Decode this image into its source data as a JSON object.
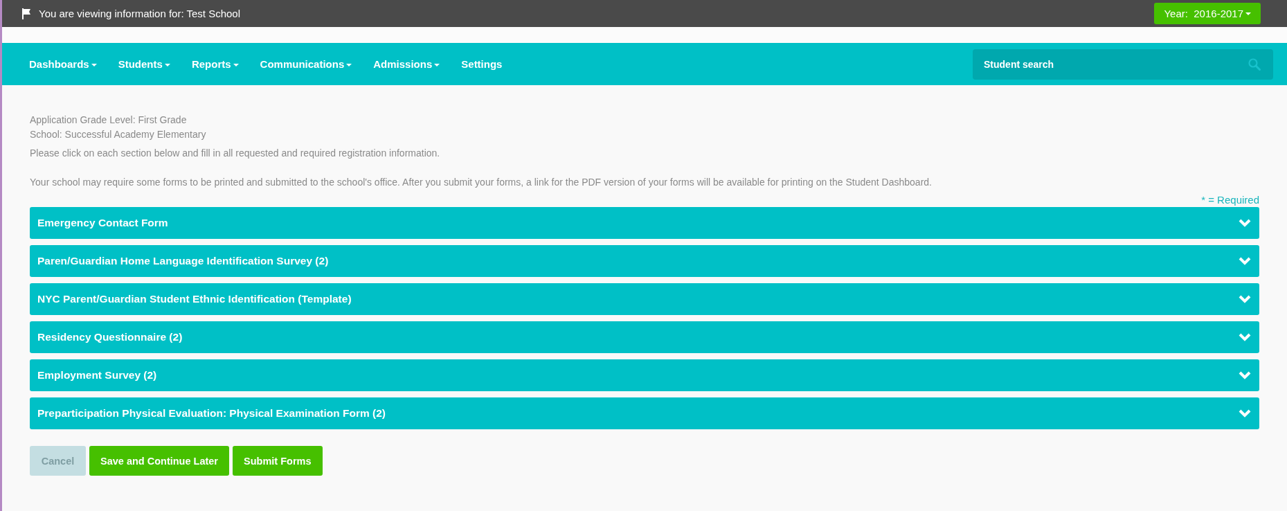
{
  "top_bar": {
    "message": "You are viewing information for: Test School",
    "year_button": "Year:  2016-2017"
  },
  "nav": {
    "items": [
      {
        "label": "Dashboards",
        "dropdown": true
      },
      {
        "label": "Students",
        "dropdown": true
      },
      {
        "label": "Reports",
        "dropdown": true
      },
      {
        "label": "Communications",
        "dropdown": true
      },
      {
        "label": "Admissions",
        "dropdown": true
      },
      {
        "label": "Settings",
        "dropdown": false
      }
    ],
    "search": {
      "placeholder": "Student search"
    }
  },
  "info": {
    "grade_level": "Application Grade Level: First Grade",
    "school": "School: Successful Academy Elementary",
    "instructions": "Please click on each section below and fill in all requested and required registration information.",
    "note": "Your school may require some forms to be printed and submitted to the school's office. After you submit your forms, a link for the PDF version of your forms will be available for printing on the Student Dashboard.",
    "required_legend": "* = Required"
  },
  "sections": [
    {
      "title": "Emergency Contact Form",
      "expanded": false
    },
    {
      "title": "Paren/Guardian Home Language Identification Survey (2)",
      "expanded": false
    },
    {
      "title": "NYC Parent/Guardian Student Ethnic Identification (Template)",
      "expanded": false
    },
    {
      "title": "Residency Questionnaire (2)",
      "expanded": false
    },
    {
      "title": "Employment Survey (2)",
      "expanded": false
    },
    {
      "title": "Preparticipation Physical Evaluation: Physical Examination Form (2)",
      "expanded": false
    }
  ],
  "buttons": [
    {
      "label": "Cancel",
      "disabled": true
    },
    {
      "label": "Save and Continue Later",
      "disabled": false
    },
    {
      "label": "Submit Forms",
      "disabled": false
    }
  ]
}
